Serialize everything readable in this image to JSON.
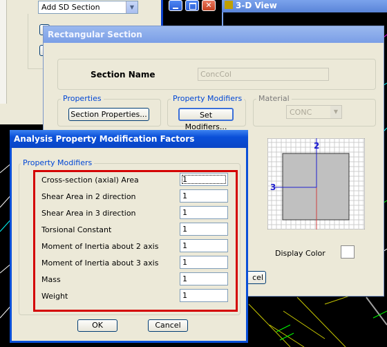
{
  "background_dialog_left": {
    "dropdown_value": "Add SD Section"
  },
  "view_window": {
    "title": "3-D View"
  },
  "rect_section": {
    "title": "Rectangular Section",
    "section_name_label": "Section Name",
    "section_name_value": "ConcCol",
    "properties_group": "Properties",
    "section_properties_button": "Section Properties...",
    "property_modifiers_group": "Property Modifiers",
    "set_modifiers_button": "Set Modifiers...",
    "material_group": "Material",
    "material_value": "CONC",
    "axis_2_label": "2",
    "axis_3_label": "3",
    "display_color_label": "Display Color",
    "cancel_partial": "cel"
  },
  "modifiers_dialog": {
    "title": "Analysis Property Modification Factors",
    "group_title": "Property Modifiers",
    "rows": [
      {
        "label": "Cross-section (axial) Area",
        "value": "1"
      },
      {
        "label": "Shear Area in 2 direction",
        "value": "1"
      },
      {
        "label": "Shear Area in 3 direction",
        "value": "1"
      },
      {
        "label": "Torsional Constant",
        "value": "1"
      },
      {
        "label": "Moment of Inertia about 2 axis",
        "value": "1"
      },
      {
        "label": "Moment of Inertia about 3 axis",
        "value": "1"
      },
      {
        "label": "Mass",
        "value": "1"
      },
      {
        "label": "Weight",
        "value": "1"
      }
    ],
    "ok_label": "OK",
    "cancel_label": "Cancel"
  },
  "colors": {
    "xp_title_blue": "#0a4fd8",
    "dialog_bg": "#ece9d8",
    "highlight_red": "#d40000"
  }
}
